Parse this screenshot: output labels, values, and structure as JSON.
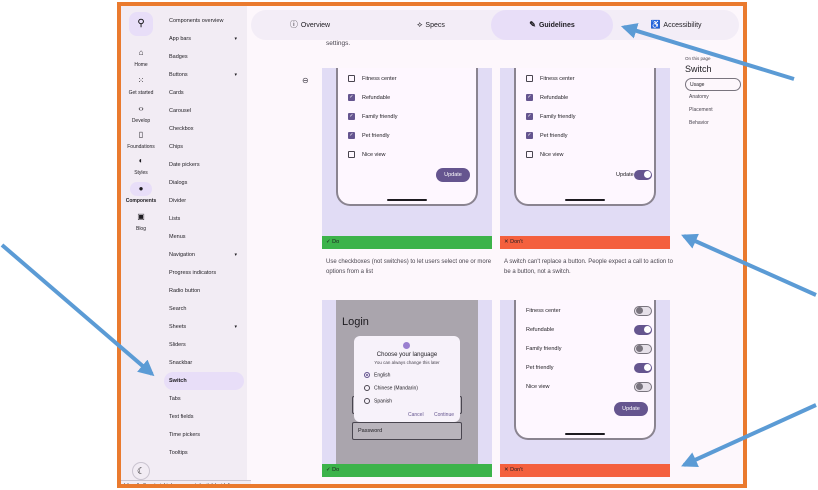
{
  "rail": {
    "items": [
      {
        "label": "Home",
        "icon": "home-icon",
        "glyph": "⌂"
      },
      {
        "label": "Get started",
        "icon": "grid-icon",
        "glyph": "⁙"
      },
      {
        "label": "Develop",
        "icon": "code-icon",
        "glyph": "‹›"
      },
      {
        "label": "Foundations",
        "icon": "book-icon",
        "glyph": "▯"
      },
      {
        "label": "Styles",
        "icon": "palette-icon",
        "glyph": "◐"
      },
      {
        "label": "Components",
        "icon": "components-icon",
        "glyph": "●"
      },
      {
        "label": "Blog",
        "icon": "blog-icon",
        "glyph": "▣"
      }
    ],
    "search_glyph": "⚲",
    "theme_glyph": "☾"
  },
  "nav": {
    "items": [
      "Components overview",
      "App bars",
      "Badges",
      "Buttons",
      "Cards",
      "Carousel",
      "Checkbox",
      "Chips",
      "Date pickers",
      "Dialogs",
      "Divider",
      "Lists",
      "Menus",
      "Navigation",
      "Progress indicators",
      "Radio button",
      "Search",
      "Sheets",
      "Sliders",
      "Snackbar",
      "Switch",
      "Tabs",
      "Text fields",
      "Time pickers",
      "Tooltips"
    ],
    "expandable": [
      "App bars",
      "Buttons",
      "Navigation",
      "Sheets"
    ],
    "active": "Switch",
    "caret": "▾"
  },
  "status_url": "https://m3.material.io/components/switch/guidelines",
  "tabs": [
    {
      "label": "Overview",
      "glyph": "ⓘ"
    },
    {
      "label": "Specs",
      "glyph": "⟡"
    },
    {
      "label": "Guidelines",
      "glyph": "✎"
    },
    {
      "label": "Accessibility",
      "glyph": "♿"
    }
  ],
  "active_tab": "Guidelines",
  "settings_text": "settings.",
  "link_glyph": "⊖",
  "example1": {
    "rows": [
      {
        "label": "Fitness center",
        "checked": false
      },
      {
        "label": "Refundable",
        "checked": true
      },
      {
        "label": "Family friendly",
        "checked": true
      },
      {
        "label": "Pet friendly",
        "checked": true
      },
      {
        "label": "Nice view",
        "checked": false
      }
    ],
    "update_label": "Update",
    "verdict": "✓ Do",
    "caption": "Use checkboxes (not switches) to let users select one or more options from a list"
  },
  "example2": {
    "rows": [
      {
        "label": "Fitness center",
        "checked": false
      },
      {
        "label": "Refundable",
        "checked": true
      },
      {
        "label": "Family friendly",
        "checked": true
      },
      {
        "label": "Pet friendly",
        "checked": true
      },
      {
        "label": "Nice view",
        "checked": false
      }
    ],
    "update_label": "Update",
    "verdict": "✕ Don't",
    "caption": "A switch can't replace a button. People expect a call to action to be a button, not a switch."
  },
  "example3": {
    "title": "Login",
    "dialog_title": "Choose your language",
    "dialog_sub": "You can always change this later",
    "options": [
      {
        "label": "English",
        "selected": true
      },
      {
        "label": "Chinese (Mandarin)",
        "selected": false
      },
      {
        "label": "Spanish",
        "selected": false
      }
    ],
    "cancel": "Cancel",
    "continue": "Continue",
    "password": "Password",
    "verdict": "✓ Do"
  },
  "example4": {
    "rows": [
      {
        "label": "Fitness center",
        "on": false
      },
      {
        "label": "Refundable",
        "on": true
      },
      {
        "label": "Family friendly",
        "on": false
      },
      {
        "label": "Pet friendly",
        "on": true
      },
      {
        "label": "Nice view",
        "on": false
      }
    ],
    "update_label": "Update",
    "verdict": "✕ Don't"
  },
  "toc": {
    "label": "On this page",
    "title": "Switch",
    "items": [
      "Usage",
      "Anatomy",
      "Placement",
      "Behavior"
    ],
    "active": "Usage"
  },
  "colors": {
    "frame": "#ea7a2e",
    "arrow": "#5b9bd5",
    "primary": "#65558f",
    "do": "#3cb34a",
    "dont": "#f4603e"
  }
}
